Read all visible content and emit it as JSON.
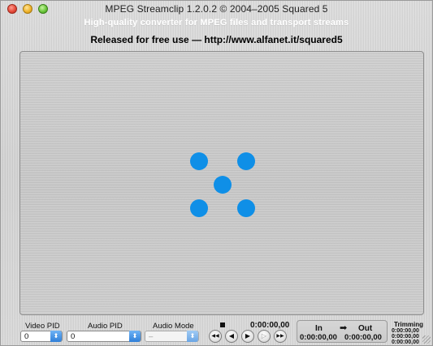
{
  "window": {
    "title": "MPEG Streamclip 1.2.0.2  ©  2004–2005 Squared 5",
    "subtitle": "High-quality converter for MPEG files and transport streams",
    "release_line": "Released for free use  —  http://www.alfanet.it/squared5"
  },
  "controls": {
    "video_pid": {
      "label": "Video PID",
      "value": "0"
    },
    "audio_pid": {
      "label": "Audio PID",
      "value": "0"
    },
    "audio_mode": {
      "label": "Audio Mode",
      "value": "–"
    },
    "current_time": "0:00:00,00",
    "transport": {
      "rewind": "◀◀",
      "step_back": "◀",
      "play": "▶",
      "step_forward": "▷",
      "fast_forward": "▶▶"
    }
  },
  "in_out": {
    "in_label": "In",
    "arrow": "➡",
    "out_label": "Out",
    "in_time": "0:00:00,00",
    "out_time": "0:00:00,00"
  },
  "trimming": {
    "label": "Trimming",
    "values": [
      "0:00:00,00",
      "0:00:00,00",
      "0:00:00,00"
    ]
  },
  "colors": {
    "dot": "#0f8fe7",
    "close": "#e54b3b",
    "minimize": "#f0b42c",
    "zoom": "#6cc63c"
  }
}
